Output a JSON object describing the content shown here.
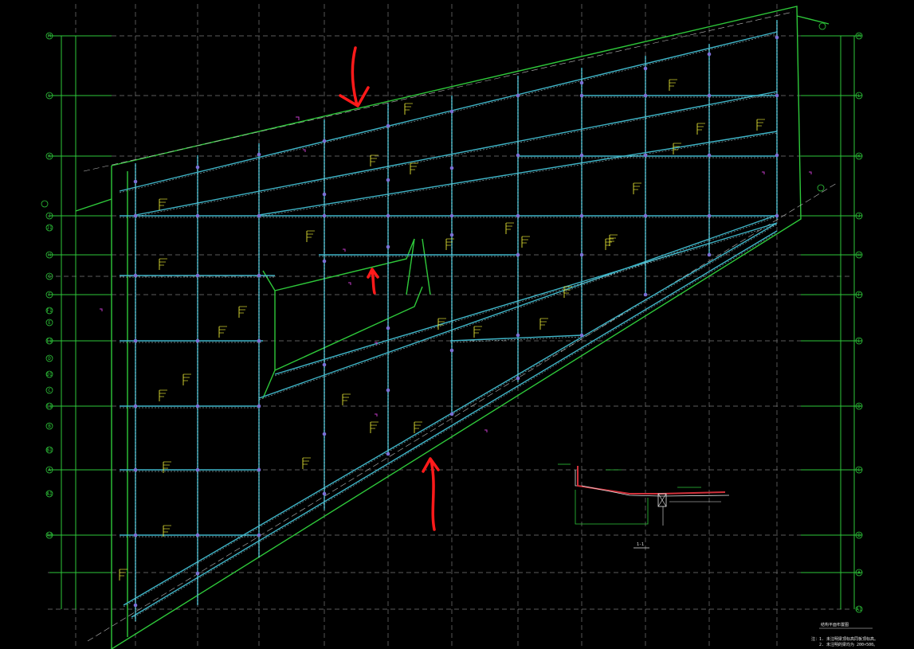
{
  "drawing": {
    "row_axes_left": [
      "M",
      "L",
      "K",
      "J",
      "J1",
      "H",
      "G",
      "F",
      "F1",
      "E",
      "E1",
      "D",
      "D1",
      "C",
      "C1",
      "B",
      "B1",
      "A",
      "A1",
      "A0"
    ],
    "row_axes_right": [
      "M",
      "L",
      "K",
      "J",
      "H",
      "F",
      "E",
      "D",
      "C",
      "B",
      "A",
      "A1"
    ],
    "section_title": "1-1",
    "notes": [
      "结构平面布置图",
      "注：1. 未注明梁顶标高同板顶标高。",
      "2. 未注明的梁均为 200×500。"
    ]
  },
  "colors": {
    "background": "#000000",
    "axis_green": "#2ec83a",
    "beam_cyan": "#3fb6c9",
    "grid_white_dashed": "#8a8a8a",
    "tag_yellow": "#ffff3a",
    "marker_magenta": "#c23cc8",
    "annotation_red": "#ff1a1a",
    "section_red": "#d0303a"
  }
}
